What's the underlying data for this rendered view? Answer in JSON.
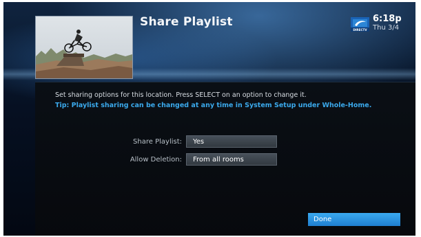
{
  "header": {
    "title": "Share Playlist",
    "logo_text": "DIRECTV",
    "time": "6:18p",
    "date": "Thu 3/4"
  },
  "panel": {
    "instruction": "Set sharing options for this location. Press SELECT on an option to change it.",
    "tip": "Tip: Playlist sharing can be changed at any time in System Setup under Whole-Home.",
    "options": [
      {
        "label": "Share Playlist:",
        "value": "Yes"
      },
      {
        "label": "Allow Deletion:",
        "value": "From all rooms"
      }
    ],
    "done_label": "Done"
  },
  "colors": {
    "tip_blue": "#3ba9ec",
    "done_blue": "#2b93e0",
    "panel_bg": "#08090d"
  },
  "icons": {
    "brand": "directv-logo-icon",
    "thumbnail": "bmx-rider-thumbnail"
  }
}
